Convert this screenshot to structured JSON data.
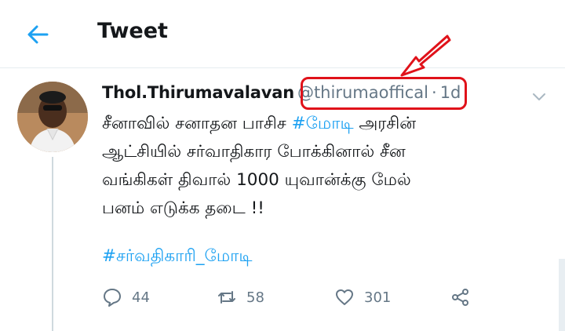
{
  "header": {
    "title": "Tweet",
    "back_icon": "arrow-left-icon"
  },
  "tweet": {
    "display_name": "Thol.Thirumavalavan",
    "handle": "@thirumaoffical",
    "separator": "·",
    "time": "1d",
    "body_lines": [
      {
        "pre": "சீனாவில் சனாதன பாசிச ",
        "hashtag": "#மோடி",
        "post": " அரசின்"
      },
      {
        "pre": "ஆட்சியில் சர்வாதிகார போக்கினால் சீன",
        "hashtag": "",
        "post": ""
      },
      {
        "pre": "வங்கிகள் திவால்  1000 யுவான்க்கு மேல்",
        "hashtag": "",
        "post": ""
      },
      {
        "pre": "பனம் எடுக்க தடை !!",
        "hashtag": "",
        "post": ""
      }
    ],
    "hashtag_line": "#சர்வதிகாரி_மோடி",
    "actions": {
      "reply_count": "44",
      "retweet_count": "58",
      "like_count": "301"
    }
  },
  "colors": {
    "accent": "#1da1f2",
    "annotation": "#e0121a",
    "muted": "#657786"
  }
}
